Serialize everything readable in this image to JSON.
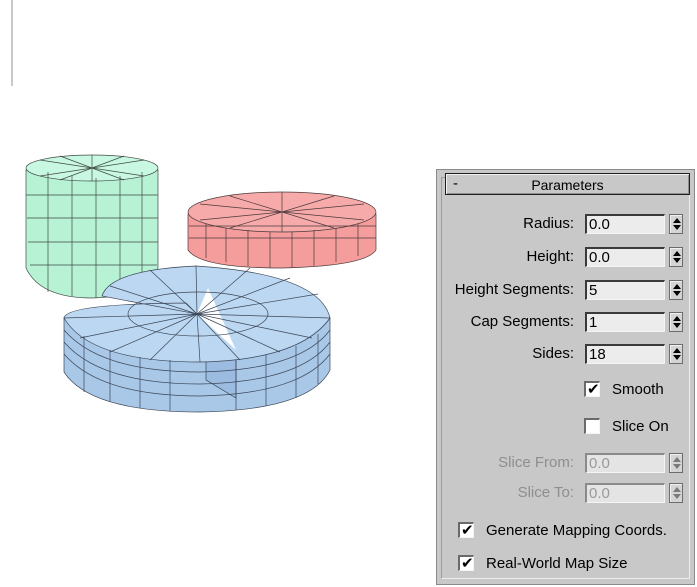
{
  "rollout": {
    "collapse_symbol": "-",
    "title": "Parameters"
  },
  "params": {
    "radius": {
      "label": "Radius:",
      "value": "0.0"
    },
    "height": {
      "label": "Height:",
      "value": "0.0"
    },
    "height_segments": {
      "label": "Height Segments:",
      "value": "5"
    },
    "cap_segments": {
      "label": "Cap Segments:",
      "value": "1"
    },
    "sides": {
      "label": "Sides:",
      "value": "18"
    },
    "slice_from": {
      "label": "Slice From:",
      "value": "0.0",
      "disabled": true
    },
    "slice_to": {
      "label": "Slice To:",
      "value": "0.0",
      "disabled": true
    }
  },
  "checkboxes": {
    "smooth": {
      "label": "Smooth",
      "checked": true
    },
    "slice_on": {
      "label": "Slice On",
      "checked": false
    },
    "generate_mapping": {
      "label": "Generate Mapping Coords.",
      "checked": true
    },
    "real_world_map_size": {
      "label": "Real-World Map Size",
      "checked": true
    }
  },
  "check_glyph": "✔",
  "icons": {
    "spinner": "spinner-arrows-icon",
    "check": "checkmark-icon"
  },
  "scene": {
    "cylinder_colors": {
      "green": "#bff7dc",
      "red": "#f7a3a3",
      "blue": "#b6d3ee"
    }
  }
}
